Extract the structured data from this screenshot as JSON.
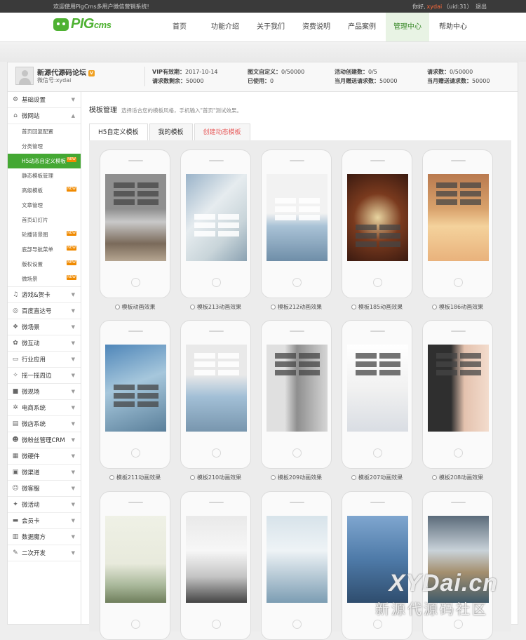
{
  "topbar": {
    "welcome": "欢迎使用PigCms多用户微信营销系统!",
    "greet": "你好,",
    "user": "xydai",
    "uid": "（uid:31）",
    "logout": "退出"
  },
  "logo": {
    "main": "PIG",
    "sub": "cms"
  },
  "nav": [
    {
      "label": "首页"
    },
    {
      "label": "功能介绍"
    },
    {
      "label": "关于我们"
    },
    {
      "label": "资费说明"
    },
    {
      "label": "产品案例"
    },
    {
      "label": "管理中心"
    },
    {
      "label": "帮助中心"
    }
  ],
  "info": {
    "site_name": "新源代源码论坛",
    "vip_badge": "V",
    "wx_id": "微信号:xydai",
    "vip_label": "VIP有效期：",
    "vip_value": "2017-10-14",
    "req_label": "请求数剩余：",
    "req_value": "50000",
    "tw_label": "图文自定义：",
    "tw_value": "0/50000",
    "used_label": "已使用：",
    "used_value": "0",
    "act_label": "活动创建数：",
    "act_value": "0/5",
    "month_label": "当月赠送请求数：",
    "month_value": "50000",
    "reqn_label": "请求数：",
    "reqn_value": "0/50000",
    "month2_label": "当月赠送请求数：",
    "month2_value": "50000"
  },
  "sidebar": {
    "top": [
      {
        "icon": "⚙",
        "label": "基础设置"
      }
    ],
    "open": {
      "icon": "⌂",
      "label": "微网站"
    },
    "subs": [
      {
        "label": "首页回复配置",
        "new": ""
      },
      {
        "label": "分类管理",
        "new": ""
      },
      {
        "label": "H5动态自定义模板",
        "new": "NEW"
      },
      {
        "label": "静态模板管理",
        "new": ""
      },
      {
        "label": "高级模板",
        "new": "NEW"
      },
      {
        "label": "文章管理",
        "new": ""
      },
      {
        "label": "首页幻灯片",
        "new": ""
      },
      {
        "label": "轮播背景图",
        "new": "NEW"
      },
      {
        "label": "底部导航菜单",
        "new": "NEW"
      },
      {
        "label": "版权设置",
        "new": "NEW"
      },
      {
        "label": "微场景",
        "new": "NEW"
      }
    ],
    "rest": [
      {
        "icon": "♫",
        "label": "游戏&贺卡"
      },
      {
        "icon": "◎",
        "label": "百度直达号"
      },
      {
        "icon": "❖",
        "label": "微场景"
      },
      {
        "icon": "✿",
        "label": "微互动"
      },
      {
        "icon": "▭",
        "label": "行业应用"
      },
      {
        "icon": "✧",
        "label": "摇一摇周边"
      },
      {
        "icon": "■",
        "label": "微现场"
      },
      {
        "icon": "✲",
        "label": "电商系统"
      },
      {
        "icon": "▤",
        "label": "微店系统"
      },
      {
        "icon": "☻",
        "label": "微粉丝管理CRM"
      },
      {
        "icon": "▦",
        "label": "微硬件"
      },
      {
        "icon": "▣",
        "label": "微渠道"
      },
      {
        "icon": "☺",
        "label": "微客服"
      },
      {
        "icon": "✦",
        "label": "微活动"
      },
      {
        "icon": "▬",
        "label": "会员卡"
      },
      {
        "icon": "▥",
        "label": "数据魔方"
      },
      {
        "icon": "✎",
        "label": "二次开发"
      }
    ]
  },
  "page": {
    "title": "模板管理",
    "hint": "选择适合您的模板风格，手机输入\"首页\"测试效果。",
    "tabs": [
      "H5自定义模板",
      "我的模板",
      "创建动态模板"
    ]
  },
  "templates": [
    {
      "label": "模板动画效果"
    },
    {
      "label": "模板213动画效果"
    },
    {
      "label": "模板212动画效果"
    },
    {
      "label": "模板185动画效果"
    },
    {
      "label": "模板186动画效果"
    },
    {
      "label": "模板211动画效果"
    },
    {
      "label": "模板210动画效果"
    },
    {
      "label": "模板209动画效果"
    },
    {
      "label": "模板207动画效果"
    },
    {
      "label": "模板208动画效果"
    },
    {
      "label": ""
    },
    {
      "label": ""
    },
    {
      "label": ""
    },
    {
      "label": ""
    },
    {
      "label": ""
    }
  ],
  "watermark": {
    "line1": "XYDai.cn",
    "line2": "新源代源码社区"
  },
  "colors": {
    "accent": "#44a833",
    "topbar": "#3a3a3a",
    "new_tag": "#f08a00"
  }
}
